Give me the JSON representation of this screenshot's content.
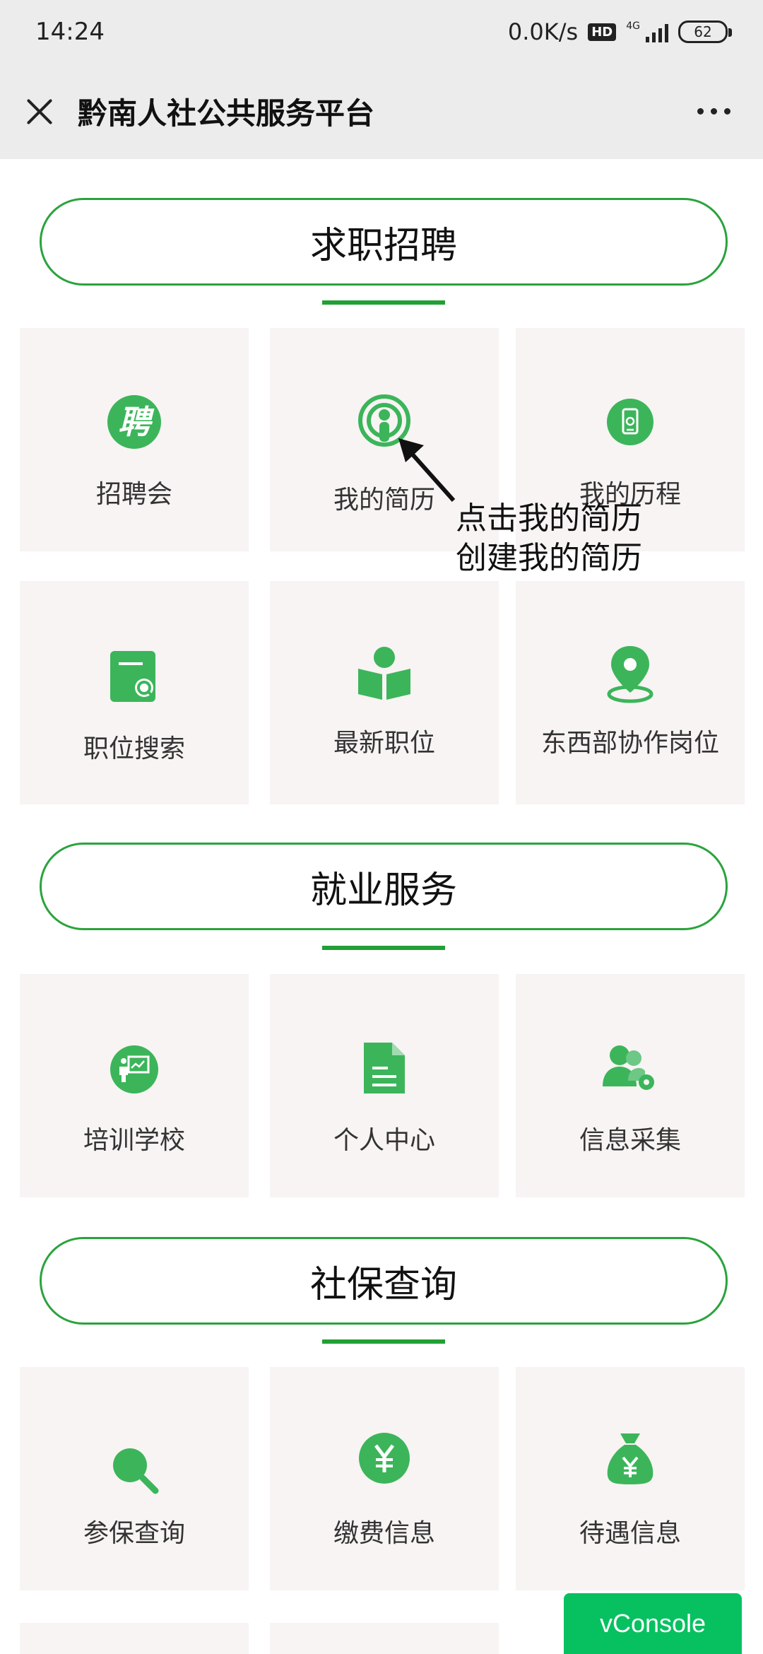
{
  "status_bar": {
    "time": "14:24",
    "speed": "0.0K/s",
    "hd": "HD",
    "network": "4G",
    "battery": "62"
  },
  "title_bar": {
    "title": "黔南人社公共服务平台"
  },
  "sections": [
    {
      "title": "求职招聘",
      "items": [
        {
          "label": "招聘会",
          "icon": "pin-character-icon"
        },
        {
          "label": "我的简历",
          "icon": "resume-podcast-icon"
        },
        {
          "label": "我的历程",
          "icon": "history-phone-icon"
        },
        {
          "label": "职位搜索",
          "icon": "job-search-icon"
        },
        {
          "label": "最新职位",
          "icon": "reading-person-icon"
        },
        {
          "label": "东西部协作岗位",
          "icon": "location-pin-icon"
        }
      ]
    },
    {
      "title": "就业服务",
      "items": [
        {
          "label": "培训学校",
          "icon": "teacher-board-icon"
        },
        {
          "label": "个人中心",
          "icon": "document-icon"
        },
        {
          "label": "信息采集",
          "icon": "users-gear-icon"
        }
      ]
    },
    {
      "title": "社保查询",
      "items": [
        {
          "label": "参保查询",
          "icon": "magnifier-icon"
        },
        {
          "label": "缴费信息",
          "icon": "yuan-coin-icon"
        },
        {
          "label": "待遇信息",
          "icon": "money-bag-icon"
        }
      ]
    }
  ],
  "annotation": {
    "line1": "点击我的简历",
    "line2": "创建我的简历"
  },
  "vconsole": {
    "label": "vConsole"
  },
  "colors": {
    "accent": "#21a035",
    "icon": "#3cb55a",
    "tile_bg": "#f7f4f3",
    "vconsole": "#07c160"
  }
}
